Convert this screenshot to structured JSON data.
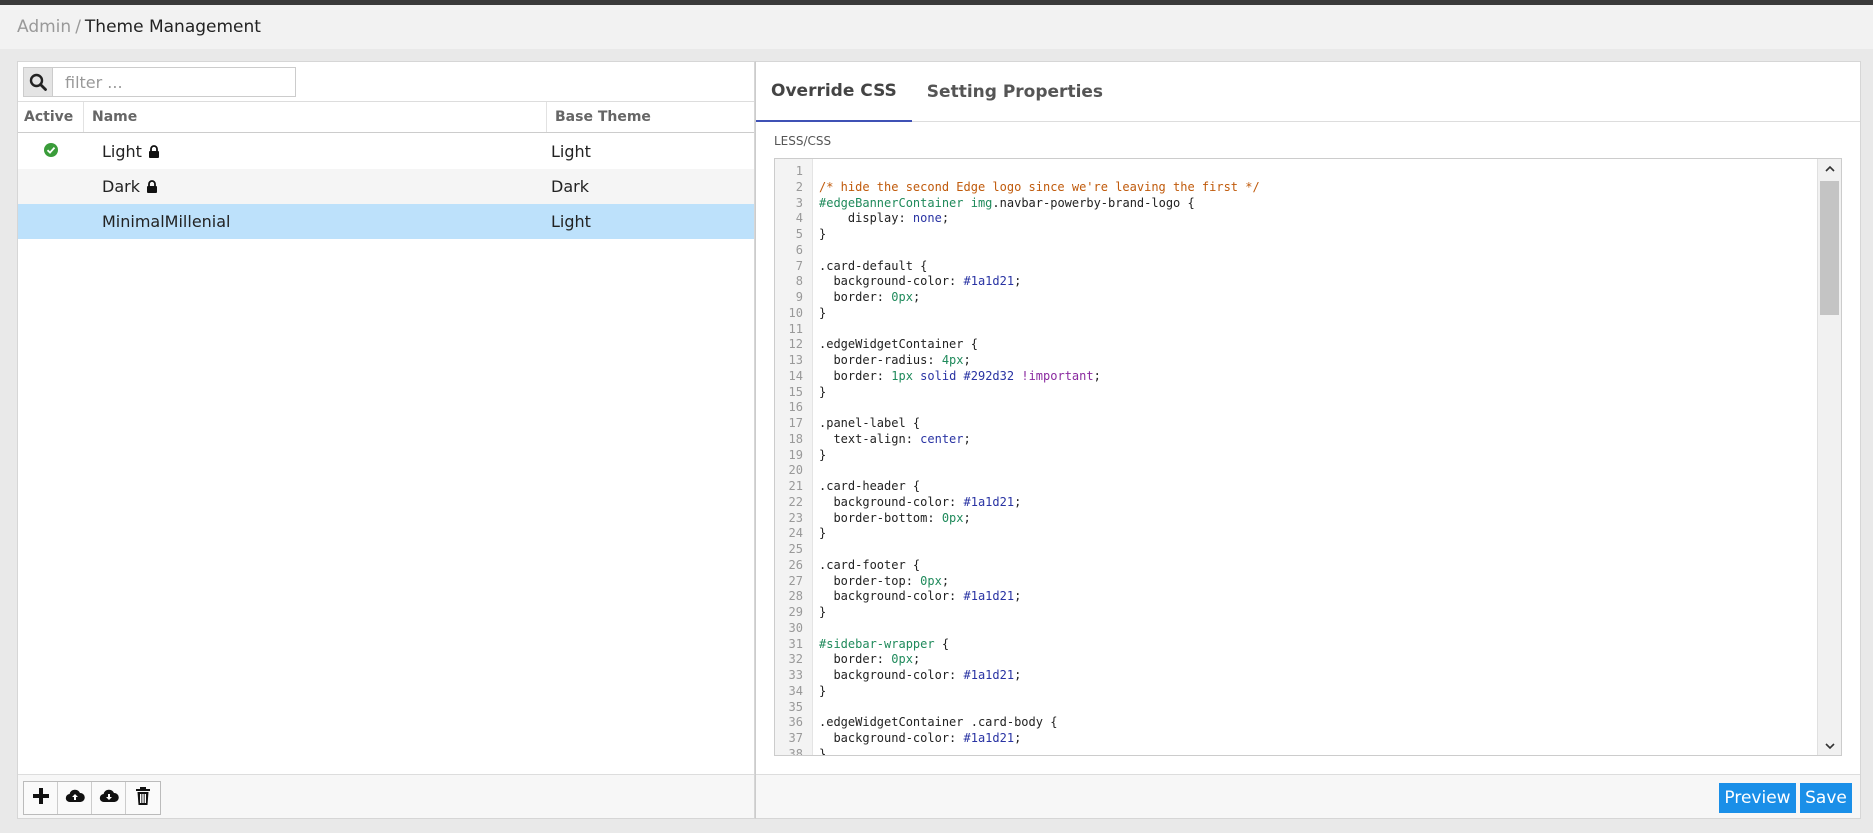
{
  "breadcrumb": {
    "parent": "Admin",
    "separator": "/",
    "current": "Theme Management"
  },
  "filter": {
    "placeholder": "filter ..."
  },
  "grid": {
    "columns": [
      "Active",
      "Name",
      "Base Theme"
    ],
    "rows": [
      {
        "active": true,
        "name": "Light",
        "locked": true,
        "base": "Light"
      },
      {
        "active": false,
        "name": "Dark",
        "locked": true,
        "base": "Dark"
      },
      {
        "active": false,
        "name": "MinimalMillenial",
        "locked": false,
        "base": "Light",
        "selected": true
      }
    ]
  },
  "toolbar": {
    "icons": [
      "plus-icon",
      "cloud-upload-icon",
      "cloud-download-icon",
      "trash-icon"
    ]
  },
  "tabs": [
    {
      "label": "Override CSS",
      "active": true
    },
    {
      "label": "Setting Properties",
      "active": false
    }
  ],
  "editor": {
    "label": "LESS/CSS",
    "lines": [
      "",
      "/* hide the second Edge logo since we're leaving the first */",
      "#edgeBannerContainer img.navbar-powerby-brand-logo {",
      "    display: none;",
      "}",
      "",
      ".card-default {",
      "  background-color: #1a1d21;",
      "  border: 0px;",
      "}",
      "",
      ".edgeWidgetContainer {",
      "  border-radius: 4px;",
      "  border: 1px solid #292d32 !important;",
      "}",
      "",
      ".panel-label {",
      "  text-align: center;",
      "}",
      "",
      ".card-header {",
      "  background-color: #1a1d21;",
      "  border-bottom: 0px;",
      "}",
      "",
      ".card-footer {",
      "  border-top: 0px;",
      "  background-color: #1a1d21;",
      "}",
      "",
      "#sidebar-wrapper {",
      "  border: 0px;",
      "  background-color: #1a1d21;",
      "}",
      "",
      ".edgeWidgetContainer .card-body {",
      "  background-color: #1a1d21;",
      "}"
    ]
  },
  "actions": {
    "preview": "Preview",
    "save": "Save"
  },
  "colors": {
    "accent": "#1a8fe8",
    "selected_row": "#bde1fb",
    "active_check": "#3a9c3a",
    "tab_underline": "#3f51b5"
  }
}
